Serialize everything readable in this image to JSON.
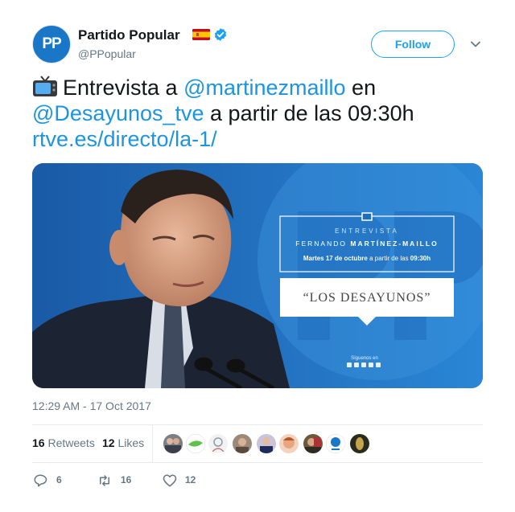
{
  "author": {
    "name": "Partido Popular",
    "handle": "@PPopular",
    "avatar_text": "PP",
    "flag": "spain-flag-icon",
    "verified": true
  },
  "follow_button": {
    "label": "Follow"
  },
  "tweet": {
    "emoji": "tv-emoji",
    "text_1": "Entrevista a ",
    "mention_1": "@martinezmaillo",
    "text_2": " en",
    "mention_2": "@Desayunos_tve",
    "text_3": " a partir de las 09:30h",
    "link": "rtve.es/directo/la-1/"
  },
  "media": {
    "kicker": "ENTREVISTA",
    "guest_first": "FERNANDO ",
    "guest_last": "MARTÍNEZ-MAILLO",
    "date_bold": "Martes 17 de octubre",
    "date_rest": " a partir de las ",
    "time_bold": "09:30h",
    "show": "“LOS DESAYUNOS”",
    "follow_us": "Síguenos en"
  },
  "timestamp": "12:29 AM - 17 Oct 2017",
  "stats": {
    "retweets_count": "16",
    "retweets_label": " Retweets",
    "likes_count": "12",
    "likes_label": " Likes"
  },
  "actions": {
    "reply_count": "6",
    "retweet_count": "16",
    "like_count": "12"
  },
  "colors": {
    "accent": "#1da1f2",
    "link": "#1b95e0",
    "muted": "#657786",
    "pp_blue": "#1a76c7"
  }
}
